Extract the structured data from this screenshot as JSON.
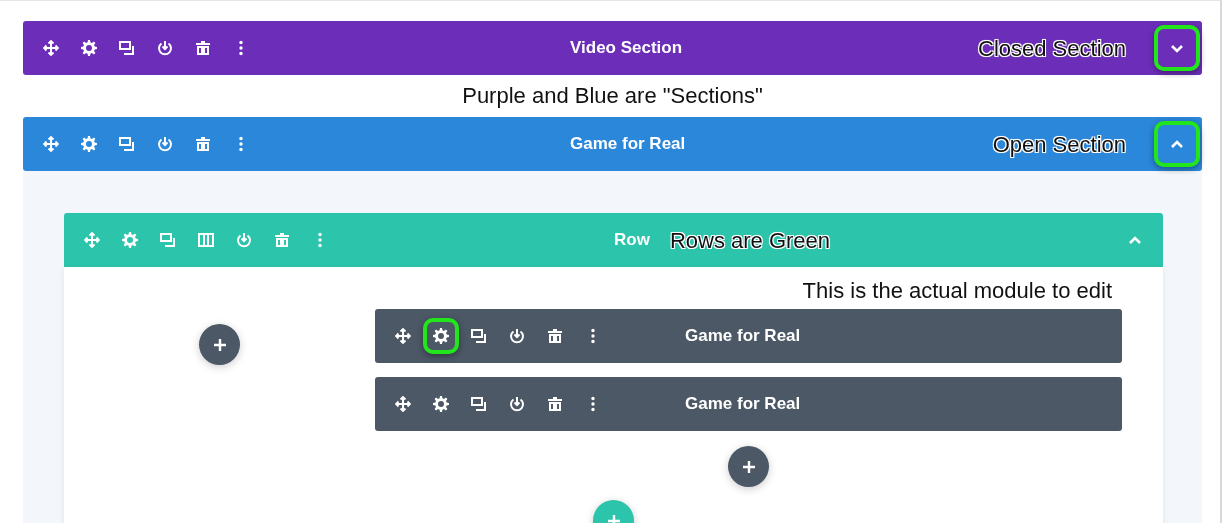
{
  "blocks": [
    {
      "kind": "section",
      "title": "Video Section",
      "color": "#6c2eb9",
      "expanded": false,
      "annotation": "Closed Section",
      "toggle_highlighted": true
    },
    {
      "kind": "note",
      "text": "Purple and Blue are \"Sections\""
    },
    {
      "kind": "section",
      "title": "Game for Real",
      "color": "#2b87da",
      "expanded": true,
      "annotation": "Open Section",
      "toggle_highlighted": true,
      "rows": [
        {
          "title": "Row",
          "annotation": "Rows are Green",
          "expanded": true,
          "columns": [
            {},
            {
              "annotation": "This is the actual module to edit",
              "modules": [
                {
                  "title": "Game for Real",
                  "settings_highlighted": true
                },
                {
                  "title": "Game for Real",
                  "settings_highlighted": false
                }
              ]
            }
          ]
        }
      ]
    }
  ]
}
